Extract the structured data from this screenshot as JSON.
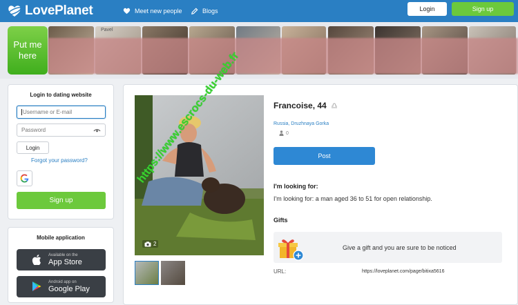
{
  "header": {
    "brand": "LovePlanet",
    "nav_meet": "Meet new people",
    "nav_blogs": "Blogs",
    "login_label": "Login",
    "signup_label": "Sign up"
  },
  "strip": {
    "put_me_here": "Put me here",
    "name_hint": "Pavel"
  },
  "login_panel": {
    "title": "Login to dating website",
    "username_placeholder": "Username or E-mail",
    "password_placeholder": "Password",
    "login_button": "Login",
    "forgot_link": "Forgot your password?",
    "signup_button": "Sign up"
  },
  "mobile_panel": {
    "title": "Mobile application",
    "appstore_sub": "Available on the",
    "appstore_main": "App Store",
    "gplay_sub": "Android app on",
    "gplay_main": "Google Play"
  },
  "profile": {
    "name_age": "Francoise, 44",
    "location": "Russia, Druzhnaya Gorka",
    "followers_count": "0",
    "photo_count": "2",
    "watermark": "https://www.escrocs-du-web.fr",
    "post_button": "Post",
    "looking_for_heading": "I'm looking for:",
    "looking_for_text": "I'm looking for: a man aged 36 to 51 for open relationship.",
    "gifts_heading": "Gifts",
    "gifts_text": "Give a gift and you are sure to be noticed",
    "url_label": "URL:",
    "url_value": "https://loveplanet.com/page/bitixa5616"
  },
  "colors": {
    "header_blue": "#2a7fc3",
    "accent_green": "#6cc93c",
    "post_blue": "#2e88d4"
  }
}
